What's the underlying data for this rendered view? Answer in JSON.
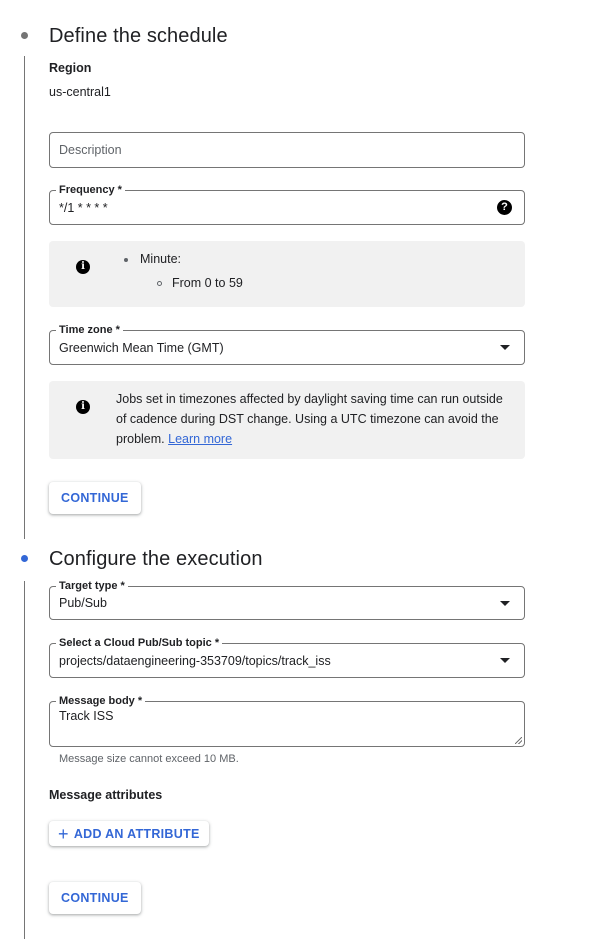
{
  "steps": [
    {
      "title": "Define the schedule",
      "state": "completed-dot",
      "region": {
        "label": "Region",
        "value": "us-central1"
      },
      "description": {
        "placeholder": "Description",
        "value": ""
      },
      "frequency": {
        "label": "Frequency *",
        "value": "*/1 * * * *",
        "help_icon": "help-icon"
      },
      "frequency_info": {
        "icon": "info-icon",
        "items": [
          {
            "label": "Minute:",
            "sub": [
              "From 0 to 59"
            ]
          }
        ]
      },
      "timezone": {
        "label": "Time zone *",
        "value": "Greenwich Mean Time (GMT)"
      },
      "timezone_info": {
        "icon": "info-icon",
        "text": "Jobs set in timezones affected by daylight saving time can run outside of cadence during DST change. Using a UTC timezone can avoid the problem.",
        "link": "Learn more"
      },
      "continue_label": "CONTINUE"
    },
    {
      "title": "Configure the execution",
      "state": "active-dot",
      "target_type": {
        "label": "Target type *",
        "value": "Pub/Sub"
      },
      "topic": {
        "label": "Select a Cloud Pub/Sub topic *",
        "value": "projects/dataengineering-353709/topics/track_iss"
      },
      "message_body": {
        "label": "Message body *",
        "value": "Track ISS",
        "hint": "Message size cannot exceed 10 MB."
      },
      "attributes": {
        "label": "Message attributes",
        "add_label": "ADD AN ATTRIBUTE"
      },
      "continue_label": "CONTINUE"
    }
  ],
  "colors": {
    "accent": "#3367d6",
    "active_dot": "#3367d6",
    "inactive_dot": "#757575",
    "info_bg": "#f1f1f1"
  }
}
